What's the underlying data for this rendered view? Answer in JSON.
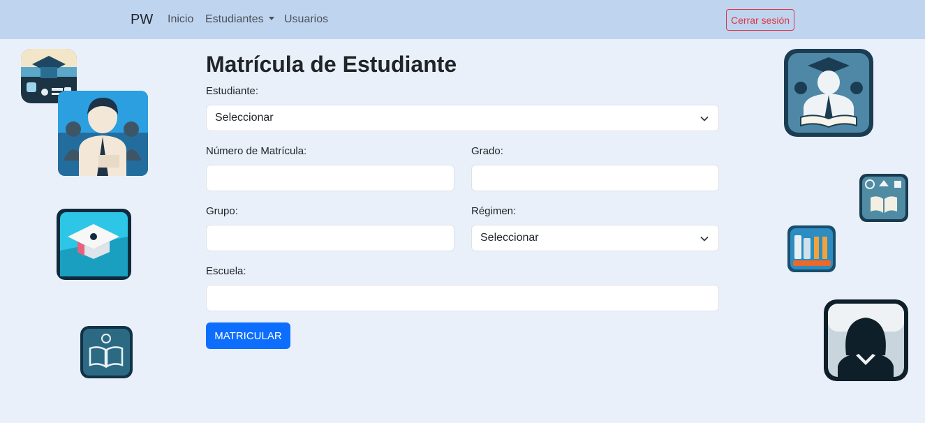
{
  "navbar": {
    "brand": "PW",
    "links": [
      {
        "label": "Inicio"
      },
      {
        "label": "Estudiantes"
      },
      {
        "label": "Usuarios"
      }
    ],
    "logout_label": "Cerrar sesión"
  },
  "form": {
    "title": "Matrícula de Estudiante",
    "estudiante": {
      "label": "Estudiante:",
      "value": "Seleccionar"
    },
    "numero_matricula": {
      "label": "Número de Matrícula:",
      "value": ""
    },
    "grado": {
      "label": "Grado:",
      "value": ""
    },
    "grupo": {
      "label": "Grupo:",
      "value": ""
    },
    "regimen": {
      "label": "Régimen:",
      "value": "Seleccionar"
    },
    "escuela": {
      "label": "Escuela:",
      "value": ""
    },
    "submit_label": "MATRICULAR"
  },
  "icons": {
    "left": [
      "graduation-cap-tech-icon",
      "student-group-icon",
      "mortarboard-icon",
      "book-location-icon"
    ],
    "right": [
      "graduate-reading-icon",
      "study-tools-icon",
      "books-pencils-icon",
      "female-avatar-icon"
    ]
  },
  "colors": {
    "navbar_bg": "#bfd4ef",
    "page_bg": "#e9f0fa",
    "primary": "#0d6efd",
    "danger": "#dc3545"
  }
}
